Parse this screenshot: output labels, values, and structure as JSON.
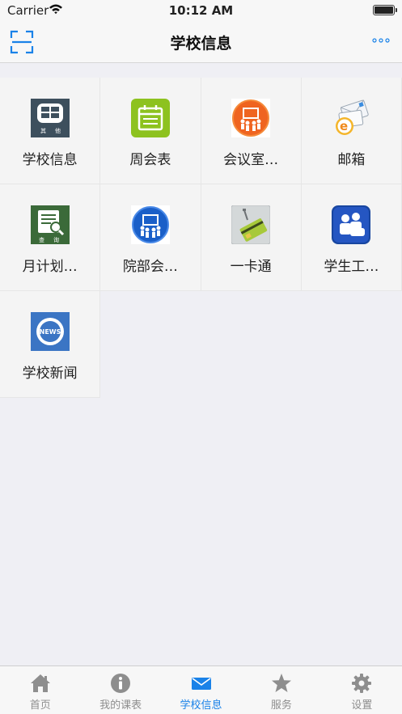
{
  "status_bar": {
    "carrier": "Carrier",
    "time": "10:12 AM"
  },
  "nav": {
    "title": "学校信息",
    "left_icon": "scan-icon",
    "right_icon": "more-icon"
  },
  "grid": {
    "items": [
      {
        "label": "学校信息",
        "icon": "other-icon"
      },
      {
        "label": "周会表",
        "icon": "calendar-icon"
      },
      {
        "label": "会议室…",
        "icon": "meeting-room-icon"
      },
      {
        "label": "邮箱",
        "icon": "mail-icon"
      },
      {
        "label": "月计划…",
        "icon": "monthly-plan-icon"
      },
      {
        "label": "院部会…",
        "icon": "department-meeting-icon"
      },
      {
        "label": "一卡通",
        "icon": "card-icon"
      },
      {
        "label": "学生工…",
        "icon": "student-work-icon"
      },
      {
        "label": "学校新闻",
        "icon": "news-icon"
      }
    ],
    "other_icon_text_1": "其",
    "other_icon_text_2": "他",
    "plan_icon_text_1": "查",
    "plan_icon_text_2": "询",
    "news_icon_text": "NEWS"
  },
  "tabbar": {
    "tabs": [
      {
        "label": "首页",
        "icon": "home-icon",
        "active": false
      },
      {
        "label": "我的课表",
        "icon": "info-icon",
        "active": false
      },
      {
        "label": "学校信息",
        "icon": "envelope-icon",
        "active": true
      },
      {
        "label": "服务",
        "icon": "star-icon",
        "active": false
      },
      {
        "label": "设置",
        "icon": "gear-icon",
        "active": false
      }
    ]
  },
  "colors": {
    "accent": "#1a82e8",
    "inactive": "#8e8e8e"
  }
}
